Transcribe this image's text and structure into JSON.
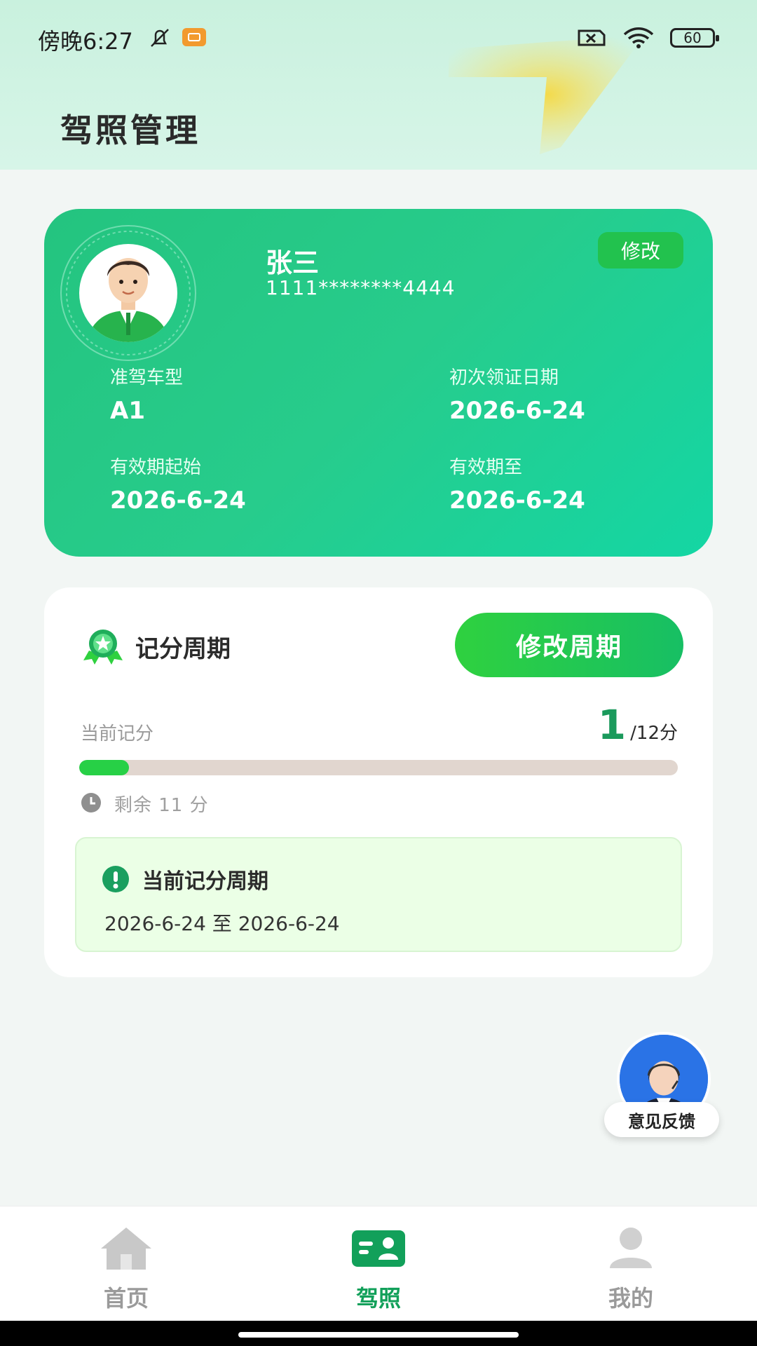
{
  "status_bar": {
    "time": "傍晚6:27",
    "battery": "60"
  },
  "header": {
    "title": "驾照管理"
  },
  "license": {
    "name": "张三",
    "number": "1111********4444",
    "edit_label": "修改",
    "fields": {
      "vehicle_type_label": "准驾车型",
      "vehicle_type_value": "A1",
      "first_issue_label": "初次领证日期",
      "first_issue_value": "2026-6-24",
      "valid_from_label": "有效期起始",
      "valid_from_value": "2026-6-24",
      "valid_to_label": "有效期至",
      "valid_to_value": "2026-6-24"
    }
  },
  "score": {
    "title": "记分周期",
    "modify_button": "修改周期",
    "current_label": "当前记分",
    "current_value": "1",
    "total": "/12分",
    "progress_fraction": 0.083,
    "remaining": "剩余 11 分",
    "period_title": "当前记分周期",
    "period_range": "2026-6-24 至 2026-6-24"
  },
  "feedback": {
    "label": "意见反馈"
  },
  "nav": {
    "items": [
      {
        "label": "首页",
        "icon": "home-icon",
        "active": false
      },
      {
        "label": "驾照",
        "icon": "license-icon",
        "active": true
      },
      {
        "label": "我的",
        "icon": "profile-icon",
        "active": false
      }
    ]
  },
  "colors": {
    "brand_green": "#12a05a",
    "card_green": "#27cc8c",
    "progress_fill": "#27d046",
    "progress_track": "#e1d6cf"
  }
}
